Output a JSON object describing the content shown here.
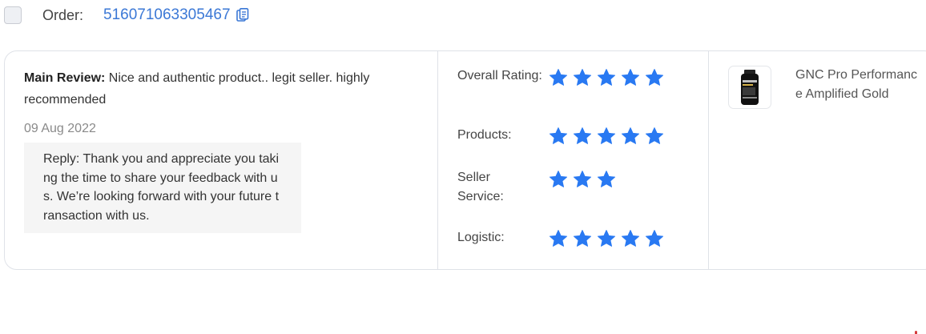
{
  "order": {
    "label": "Order:",
    "number": "516071063305467"
  },
  "review": {
    "main_label": "Main Review:",
    "main_text": " Nice and authentic product.. legit seller. highly recommended",
    "date": "09 Aug 2022",
    "reply": "Reply: Thank you and appreciate you taking the time to share your feedback with us. We’re looking forward with your future transaction with us."
  },
  "ratings": [
    {
      "label": "Overall Rating:",
      "stars": 5
    },
    {
      "label": "Products:",
      "stars": 5
    },
    {
      "label": "Seller Service:",
      "stars": 3
    },
    {
      "label": "Logistic:",
      "stars": 5
    }
  ],
  "product": {
    "name": "GNC Pro Performance Amplified Gold"
  },
  "colors": {
    "accent": "#3b78d6",
    "star": "#2979f2"
  }
}
